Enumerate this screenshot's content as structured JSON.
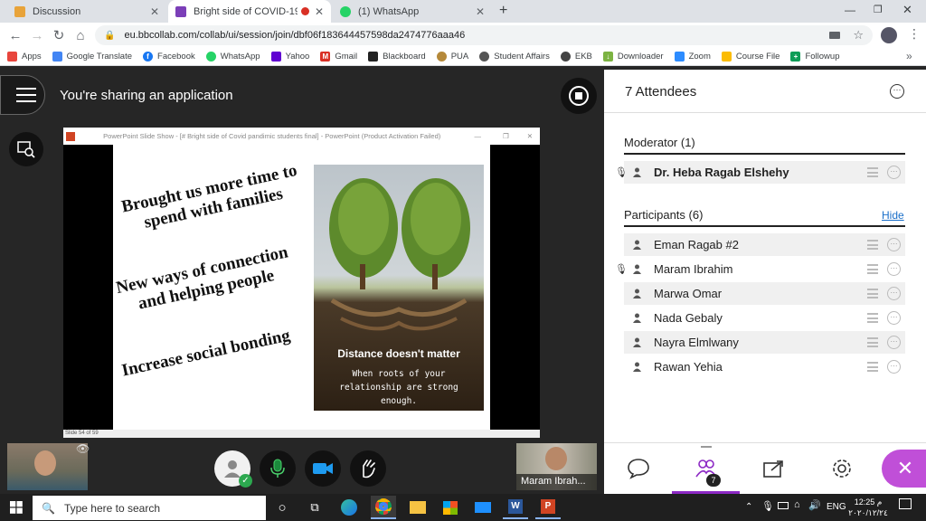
{
  "browser": {
    "tabs": [
      {
        "title": "Discussion",
        "color": "#e8a33a"
      },
      {
        "title": "Bright side of COVID-19 pan",
        "color": "#7b3fb8"
      },
      {
        "title": "(1) WhatsApp",
        "color": "#25d366"
      }
    ],
    "url": "eu.bbcollab.com/collab/ui/session/join/dbf06f183644457598da2474776aaa46",
    "bookmarks": [
      {
        "label": "Apps",
        "color": "#e8453c"
      },
      {
        "label": "Google Translate",
        "color": "#4285f4"
      },
      {
        "label": "Facebook",
        "color": "#1877f2"
      },
      {
        "label": "WhatsApp",
        "color": "#25d366"
      },
      {
        "label": "Yahoo",
        "color": "#6001d2"
      },
      {
        "label": "Gmail",
        "color": "#d93025"
      },
      {
        "label": "Blackboard",
        "color": "#222222"
      },
      {
        "label": "PUA",
        "color": "#b5893a"
      },
      {
        "label": "Student Affairs",
        "color": "#555555"
      },
      {
        "label": "EKB",
        "color": "#444444"
      },
      {
        "label": "Downloader",
        "color": "#7cb342"
      },
      {
        "label": "Zoom",
        "color": "#2d8cff"
      },
      {
        "label": "Course File",
        "color": "#fbbc04"
      },
      {
        "label": "Followup",
        "color": "#0f9d58"
      }
    ]
  },
  "share": {
    "status_text": "You're sharing an application"
  },
  "ppt": {
    "window_title": "PowerPoint Slide Show - [# Bright side of Covid pandimic students final] - PowerPoint (Product Activation Failed)",
    "slide_counter": "Slide 54 of 59",
    "bullets": [
      "Brought us more time to\nspend with families",
      "New ways of connection\nand helping people",
      "Increase social bonding"
    ],
    "image_heading": "Distance doesn't matter",
    "image_caption": "When roots of your relationship are strong enough."
  },
  "video": {
    "remote_name": "Maram Ibrah..."
  },
  "panel": {
    "title": "7 Attendees",
    "moderator_heading": "Moderator (1)",
    "moderator": "Dr. Heba Ragab Elshehy",
    "participants_heading": "Participants (6)",
    "hide_label": "Hide",
    "participants": [
      "Eman Ragab #2",
      "Maram Ibrahim",
      "Marwa Omar",
      "Nada Gebaly",
      "Nayra Elmlwany",
      "Rawan Yehia"
    ],
    "attendee_badge": "7"
  },
  "taskbar": {
    "search_placeholder": "Type here to search",
    "lang": "ENG",
    "time": "12:25 م",
    "date": "٢٠٢٠/١٢/٢٤"
  },
  "colors": {
    "accent": "#8c28c4",
    "close_button": "#c04fd8",
    "mic_green": "#1b8a3c"
  }
}
